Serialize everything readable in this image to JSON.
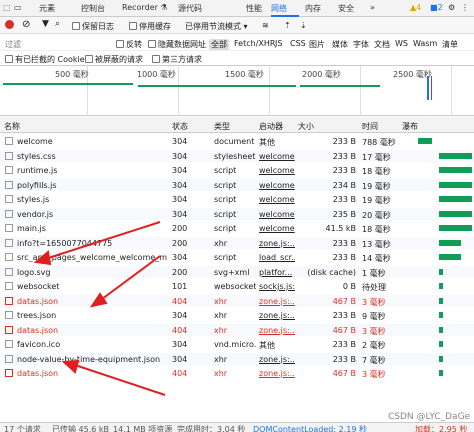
{
  "tabs": [
    "元素",
    "控制台",
    "Recorder ⚗",
    "源代码",
    "网络",
    "性能",
    "内存",
    "安全"
  ],
  "badges": {
    "warn": "4",
    "info": "2"
  },
  "toolbar": {
    "preserve_log": "保留日志",
    "disable_cache": "停用缓存",
    "throttle": "已停用节流模式"
  },
  "filter": {
    "label": "过滤",
    "invert": "反转",
    "hide_data_urls": "隐藏数据网址",
    "types": [
      "全部",
      "Fetch/XHR",
      "JS",
      "CSS",
      "图片",
      "媒体",
      "字体",
      "文档",
      "WS",
      "Wasm",
      "清单"
    ],
    "blocked_cookie": "有已拦截的 Cookie",
    "blocked_requests": "被屏蔽的请求",
    "third_party": "第三方请求"
  },
  "overview_ticks": [
    "500 毫秒",
    "1000 毫秒",
    "1500 毫秒",
    "2000 毫秒",
    "2500 毫秒"
  ],
  "columns": [
    "名称",
    "状态",
    "类型",
    "启动器",
    "大小",
    "时间",
    "瀑布"
  ],
  "rows": [
    {
      "name": "welcome",
      "status": "304",
      "type": "document",
      "initiator": "其他",
      "size": "233 B",
      "time": "788 毫秒",
      "err": false
    },
    {
      "name": "styles.css",
      "status": "304",
      "type": "stylesheet",
      "initiator": "welcome",
      "size": "233 B",
      "time": "17 毫秒",
      "err": false
    },
    {
      "name": "runtime.js",
      "status": "304",
      "type": "script",
      "initiator": "welcome",
      "size": "233 B",
      "time": "18 毫秒",
      "err": false
    },
    {
      "name": "polyfills.js",
      "status": "304",
      "type": "script",
      "initiator": "welcome",
      "size": "234 B",
      "time": "19 毫秒",
      "err": false
    },
    {
      "name": "styles.js",
      "status": "304",
      "type": "script",
      "initiator": "welcome",
      "size": "233 B",
      "time": "19 毫秒",
      "err": false
    },
    {
      "name": "vendor.js",
      "status": "304",
      "type": "script",
      "initiator": "welcome",
      "size": "235 B",
      "time": "20 毫秒",
      "err": false
    },
    {
      "name": "main.js",
      "status": "200",
      "type": "script",
      "initiator": "welcome",
      "size": "41.5 kB",
      "time": "18 毫秒",
      "err": false
    },
    {
      "name": "info?t=1650077044775",
      "status": "200",
      "type": "xhr",
      "initiator": "zone.js:...",
      "size": "233 B",
      "time": "13 毫秒",
      "err": false
    },
    {
      "name": "src_app_pages_welcome_welcome_modul...",
      "status": "304",
      "type": "script",
      "initiator": "load_scr...",
      "size": "233 B",
      "time": "14 毫秒",
      "err": false
    },
    {
      "name": "logo.svg",
      "status": "200",
      "type": "svg+xml",
      "initiator": "platfor...",
      "size": "(disk cache)",
      "time": "1 毫秒",
      "err": false
    },
    {
      "name": "websocket",
      "status": "101",
      "type": "websocket",
      "initiator": "sockjs.js:...",
      "size": "0 B",
      "time": "待处理",
      "err": false
    },
    {
      "name": "datas.json",
      "status": "404",
      "type": "xhr",
      "initiator": "zone.js:...",
      "size": "467 B",
      "time": "3 毫秒",
      "err": true
    },
    {
      "name": "trees.json",
      "status": "304",
      "type": "xhr",
      "initiator": "zone.js:...",
      "size": "233 B",
      "time": "9 毫秒",
      "err": false
    },
    {
      "name": "datas.json",
      "status": "404",
      "type": "xhr",
      "initiator": "zone.js:...",
      "size": "467 B",
      "time": "3 毫秒",
      "err": true
    },
    {
      "name": "favicon.ico",
      "status": "304",
      "type": "vnd.micro...",
      "initiator": "其他",
      "size": "233 B",
      "time": "2 毫秒",
      "err": false
    },
    {
      "name": "node-value-by-time-equipment.json",
      "status": "304",
      "type": "xhr",
      "initiator": "zone.js:...",
      "size": "233 B",
      "time": "7 毫秒",
      "err": false
    },
    {
      "name": "datas.json",
      "status": "404",
      "type": "xhr",
      "initiator": "zone.js:...",
      "size": "467 B",
      "time": "3 毫秒",
      "err": true
    }
  ],
  "footer": [
    "17 个请求",
    "已传输 45.6 kB",
    "14.1 MB 项资源",
    "完成用时：3.04 秒",
    "DOMContentLoaded: 2.19 秒",
    "加载：2.95 秒"
  ],
  "watermark": "CSDN @LYC_DaGe",
  "colors": {
    "accent": "#1a73e8",
    "error": "#d93025",
    "waterfall": "#0f9d58",
    "arrow": "#e02020"
  }
}
